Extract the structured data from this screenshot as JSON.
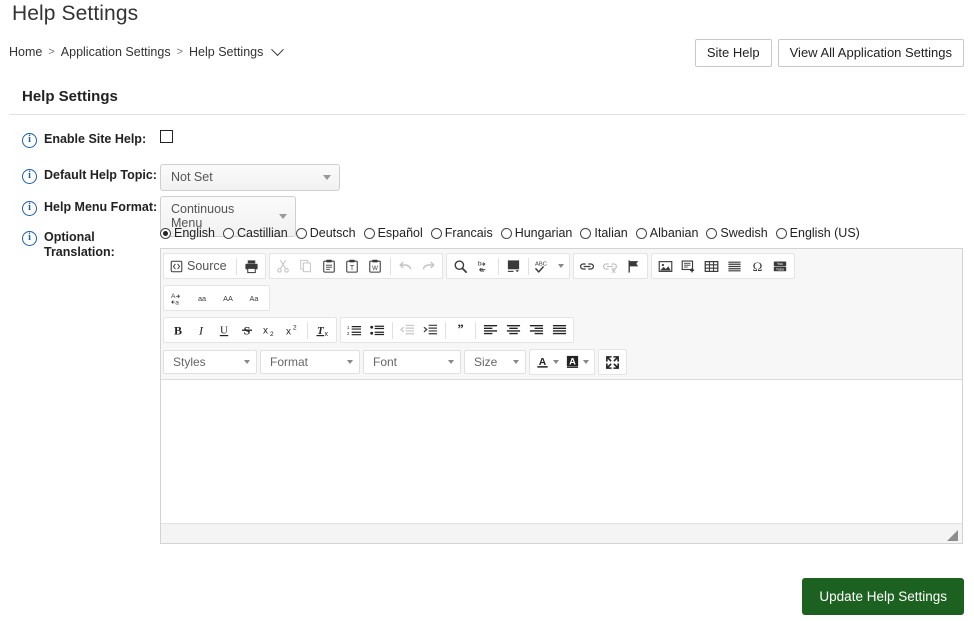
{
  "header": {
    "title": "Help Settings",
    "breadcrumb": [
      {
        "label": "Home"
      },
      {
        "label": "Application Settings"
      },
      {
        "label": "Help Settings"
      }
    ],
    "separator": ">",
    "buttons": {
      "site_help": "Site Help",
      "view_all": "View All Application Settings"
    }
  },
  "section": {
    "title": "Help Settings"
  },
  "form": {
    "enable_site_help": {
      "label": "Enable Site Help:",
      "checked": false,
      "info_icon": "info-icon"
    },
    "default_help_topic": {
      "label": "Default Help Topic:",
      "value": "Not Set",
      "info_icon": "info-icon"
    },
    "help_menu_format": {
      "label": "Help Menu Format:",
      "value": "Continuous Menu",
      "info_icon": "info-icon"
    },
    "optional_translation": {
      "label_line1": "Optional",
      "label_line2": "Translation:",
      "info_icon": "info-icon",
      "selected": "English",
      "languages": [
        "English",
        "Castillian",
        "Deutsch",
        "Español",
        "Francais",
        "Hungarian",
        "Italian",
        "Albanian",
        "Swedish",
        "English (US)"
      ]
    }
  },
  "editor": {
    "row1": {
      "source_label": "Source",
      "icons_group1": [
        "source-icon",
        "print-icon"
      ],
      "icons_group2": [
        "cut-icon",
        "copy-icon",
        "paste-icon",
        "paste-text-icon",
        "paste-word-icon",
        "undo-icon",
        "redo-icon"
      ],
      "icons_group3": [
        "find-icon",
        "replace-icon",
        "select-all-icon",
        "spellcheck-icon"
      ],
      "icons_group4": [
        "link-icon",
        "unlink-icon",
        "anchor-icon"
      ],
      "icons_group5": [
        "image-icon",
        "flash-icon",
        "table-icon",
        "horizontal-rule-icon",
        "special-char-icon",
        "youtube-icon"
      ]
    },
    "row2": {
      "icons": [
        "remove-format-icon",
        "small-text-icon",
        "large-text-icon",
        "mixed-case-icon"
      ]
    },
    "row3": {
      "icons_group1": [
        "bold-icon",
        "italic-icon",
        "underline-icon",
        "strikethrough-icon",
        "subscript-icon",
        "superscript-icon",
        "remove-format-text-icon"
      ],
      "icons_group2": [
        "numbered-list-icon",
        "bulleted-list-icon",
        "outdent-icon",
        "indent-icon",
        "blockquote-icon",
        "align-left-icon",
        "align-center-icon",
        "align-right-icon",
        "align-justify-icon"
      ]
    },
    "row4": {
      "styles": "Styles",
      "format": "Format",
      "font": "Font",
      "size": "Size",
      "text_color_icon": "text-color-icon",
      "bg_color_icon": "background-color-icon",
      "maximize_icon": "maximize-icon"
    },
    "content": "",
    "resize_handle": "resize-grip-icon"
  },
  "footer": {
    "submit_label": "Update Help Settings"
  },
  "colors": {
    "accent_green": "#1d6120",
    "info_blue": "#1c5fa8",
    "toolbar_bg": "#f7f7f7",
    "border": "#d3d3d3"
  }
}
